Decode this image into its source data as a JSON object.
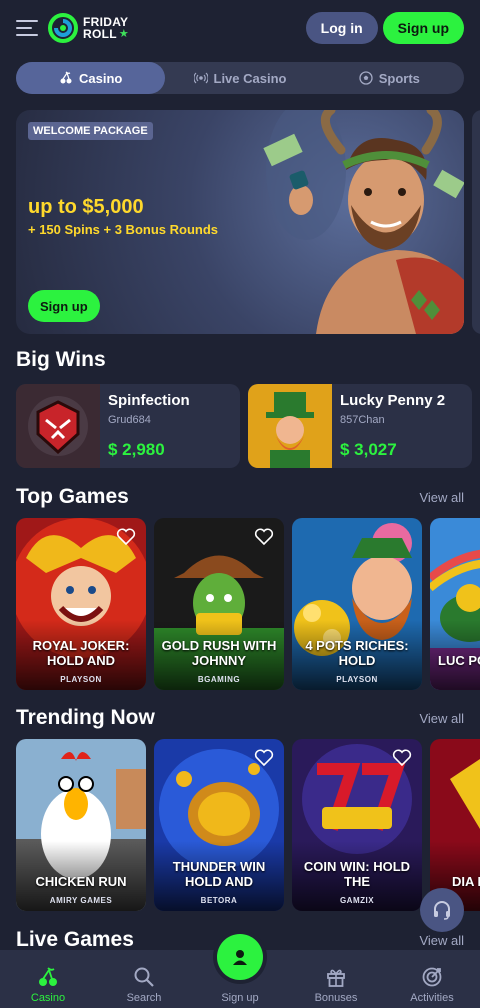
{
  "header": {
    "logo_line1": "FRIDAY",
    "logo_line2": "ROLL",
    "login_label": "Log in",
    "signup_label": "Sign up"
  },
  "tabs": [
    {
      "label": "Casino",
      "icon": "cherry-icon",
      "active": true
    },
    {
      "label": "Live Casino",
      "icon": "live-icon",
      "active": false
    },
    {
      "label": "Sports",
      "icon": "soccer-ball-icon",
      "active": false
    }
  ],
  "banner": {
    "badge": "WELCOME PACKAGE",
    "headline": "up to $5,000",
    "subline": "+ 150 Spins + 3 Bonus Rounds",
    "cta": "Sign up"
  },
  "big_wins": {
    "title": "Big Wins",
    "items": [
      {
        "game": "Spinfection",
        "user": "Grud684",
        "amount": "$ 2,980"
      },
      {
        "game": "Lucky Penny 2",
        "user": "857Chan",
        "amount": "$ 3,027"
      }
    ]
  },
  "top_games": {
    "title": "Top Games",
    "view_all": "View all",
    "items": [
      {
        "name": "ROYAL JOKER: HOLD AND",
        "provider": "PLAYSON"
      },
      {
        "name": "GOLD RUSH WITH JOHNNY",
        "provider": "BGAMING"
      },
      {
        "name": "4 POTS RICHES: HOLD",
        "provider": "PLAYSON"
      },
      {
        "name": "LUC POT",
        "provider": ""
      }
    ]
  },
  "trending": {
    "title": "Trending Now",
    "view_all": "View all",
    "items": [
      {
        "name": "CHICKEN RUN",
        "provider": "AMIRY GAMES"
      },
      {
        "name": "THUNDER WIN HOLD AND",
        "provider": "BETORA"
      },
      {
        "name": "COIN WIN: HOLD THE",
        "provider": "GAMZIX"
      },
      {
        "name": "DIA POW",
        "provider": ""
      }
    ]
  },
  "live_games": {
    "title": "Live Games",
    "view_all": "View all"
  },
  "bottom_nav": [
    {
      "label": "Casino",
      "icon": "cherry-icon",
      "active": true
    },
    {
      "label": "Search",
      "icon": "search-icon",
      "active": false
    },
    {
      "label": "Sign up",
      "icon": "user-icon",
      "active": false
    },
    {
      "label": "Bonuses",
      "icon": "gift-icon",
      "active": false
    },
    {
      "label": "Activities",
      "icon": "target-icon",
      "active": false
    }
  ],
  "colors": {
    "background": "#1e2233",
    "accent_green": "#2cf23f",
    "banner_yellow": "#ffd92c",
    "card": "#2b3046"
  }
}
